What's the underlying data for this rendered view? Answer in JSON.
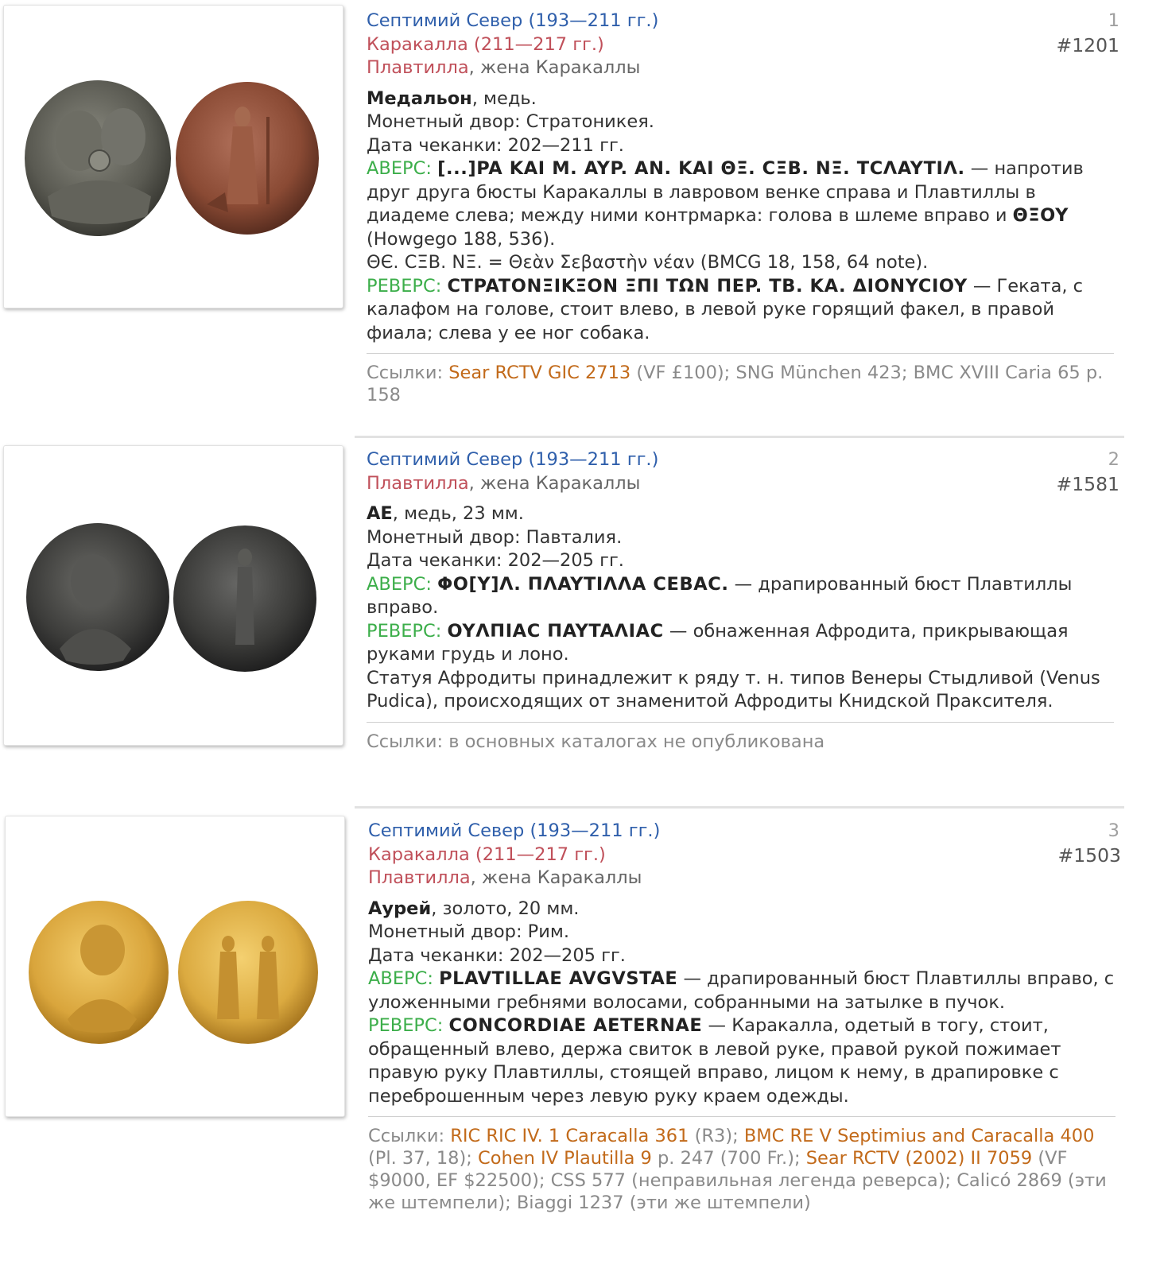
{
  "entries": [
    {
      "index": "1",
      "inventory": "#1201",
      "ruler_line1": "Септимий Север (193—211 гг.)",
      "ruler_line2": "Каракалла (211—217 гг.)",
      "ruler_line3_name": "Плавтилла",
      "ruler_line3_rest": ", жена Каракаллы",
      "denomination": "Медальон",
      "material": ", медь.",
      "mint": "Монетный двор: Стратоникея.",
      "date": "Дата чеканки: 202—211 гг.",
      "obverse_label": "АВЕРС:",
      "obverse_legend": "[...]PA KAI M. AYP. AN. KAI ΘΞ. CΞB. NΞ. TCΛAYTIΛ.",
      "obverse_text": " — напротив друг друга бюсты Каракаллы в лавровом венке справа и Плавтиллы в диадеме слева; между ними контрмарка: голова в шлеме вправо и ",
      "obverse_cm": "ΘΞOY",
      "obverse_tail": " (Howgego 188, 536).",
      "note": "ΘЄ. CΞB. NΞ. = Θεὰν Σεβαστὴν νέαν (BMCG 18, 158, 64 note).",
      "reverse_label": "РЕВЕРС:",
      "reverse_legend": "CTPATONΞIKΞON ΞΠI TΩN ΠEP. TB. KA. ΔIONYCIOY",
      "reverse_text": " — Геката, с калафом на голове, стоит влево, в левой руке горящий факел, в правой фиала; слева у ее ног собака.",
      "refs_label": "Ссылки: ",
      "refs_link1": "Sear RCTV GIC 2713",
      "refs_rest": " (VF £100); SNG München 423; BMC XVIII Caria 65 p. 158"
    },
    {
      "index": "2",
      "inventory": "#1581",
      "ruler_line1": "Септимий Север (193—211 гг.)",
      "ruler_line3_name": "Плавтилла",
      "ruler_line3_rest": ", жена Каракаллы",
      "denomination": "AE",
      "material": ", медь, 23 мм.",
      "mint": "Монетный двор: Павталия.",
      "date": "Дата чеканки: 202—205 гг.",
      "obverse_label": "АВЕРС:",
      "obverse_legend": "ΦO[Y]Λ. ΠΛAYTIΛΛA CEBAC.",
      "obverse_text": " — драпированный бюст Плавтиллы вправо.",
      "reverse_label": "РЕВЕРС:",
      "reverse_legend": "OYΛΠIAC ΠAYTAΛIAC",
      "reverse_text": " — обнаженная Афродита, прикрывающая руками грудь и лоно.",
      "note": "Статуя Афродиты принадлежит к ряду т. н. типов Венеры Стыдливой (Venus Pudica), происходящих от знаменитой Афродиты Книдской Праксителя.",
      "refs_label": "Ссылки: ",
      "refs_rest": "в основных каталогах не опубликована"
    },
    {
      "index": "3",
      "inventory": "#1503",
      "ruler_line1": "Септимий Север (193—211 гг.)",
      "ruler_line2": "Каракалла (211—217 гг.)",
      "ruler_line3_name": "Плавтилла",
      "ruler_line3_rest": ", жена Каракаллы",
      "denomination": "Аурей",
      "material": ", золото, 20 мм.",
      "mint": "Монетный двор: Рим.",
      "date": "Дата чеканки: 202—205 гг.",
      "obverse_label": "АВЕРС:",
      "obverse_legend": "PLAVTILLAE AVGVSTAE",
      "obverse_text": " — драпированный бюст Плавтиллы вправо, с уложенными гребнями волосами, собранными на затылке в пучок.",
      "reverse_label": "РЕВЕРС:",
      "reverse_legend": "CONCORDIAE AETERNAE",
      "reverse_text": " — Каракалла, одетый в тогу, стоит, обращенный влево, держа свиток в левой руке, правой рукой пожимает правую руку Плавтиллы, стоящей вправо, лицом к нему, в драпировке с переброшенным через левую руку краем одежды.",
      "refs_label": "Ссылки: ",
      "refs_link1": "RIC RIC IV. 1 Caracalla 361",
      "refs_mid1": " (R3); ",
      "refs_link2": "BMC RE V Septimius and Caracalla 400",
      "refs_mid2": " (Pl. 37, 18); ",
      "refs_link3": "Cohen IV Plautilla 9",
      "refs_mid3": " p. 247 (700 Fr.); ",
      "refs_link4": "Sear RCTV (2002) II 7059",
      "refs_rest": " (VF $9000, EF $22500); CSS 577 (неправильная легенда реверса); Calicó 2869 (эти же штемпели); Biaggi 1237 (эти же штемпели)"
    }
  ],
  "colors": {
    "ruler_blue": "#2f5fab",
    "ruler_red": "#c0505a",
    "label_green": "#3cae4a",
    "link_orange": "#c26a1a",
    "coin_bronze": "#5a5a52",
    "coin_red_bronze": "#8a4a34",
    "coin_dark": "#3c3c3c",
    "coin_gold": "#d9a53c"
  },
  "icons": [
    "coin-obverse-image",
    "coin-reverse-image"
  ]
}
